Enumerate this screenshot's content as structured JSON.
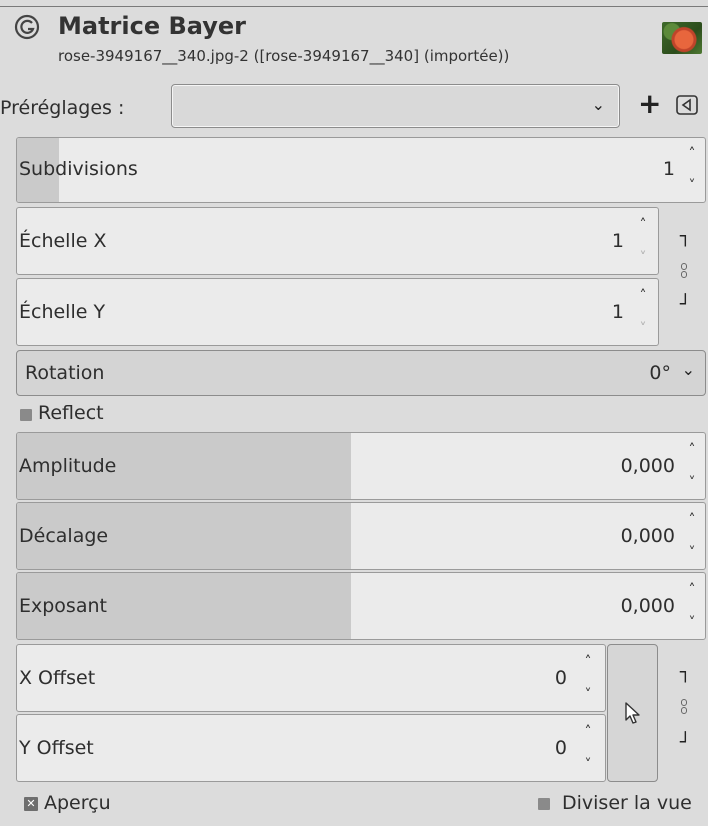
{
  "header": {
    "title": "Matrice Bayer",
    "subtitle": "rose-3949167__340.jpg-2 ([rose-3949167__340] (importée))"
  },
  "presets": {
    "label": "Préréglages :",
    "value": ""
  },
  "fields": {
    "subdivisions": {
      "label": "Subdivisions",
      "value": "1",
      "fill": 0.06
    },
    "scale_x": {
      "label": "Échelle X",
      "value": "1"
    },
    "scale_y": {
      "label": "Échelle Y",
      "value": "1"
    },
    "rotation": {
      "label": "Rotation",
      "value": "0°"
    },
    "reflect": {
      "label": "Reflect",
      "checked": false
    },
    "amplitude": {
      "label": "Amplitude",
      "value": "0,000",
      "fill": 0.5
    },
    "decalage": {
      "label": "Décalage",
      "value": "0,000",
      "fill": 0.5
    },
    "exposant": {
      "label": "Exposant",
      "value": "0,000",
      "fill": 0.5
    },
    "x_offset": {
      "label": "X Offset",
      "value": "0"
    },
    "y_offset": {
      "label": "Y Offset",
      "value": "0"
    }
  },
  "footer": {
    "preview": {
      "label": "Aperçu",
      "checked": true
    },
    "split_view": {
      "label": "Diviser la vue",
      "checked": false
    }
  }
}
